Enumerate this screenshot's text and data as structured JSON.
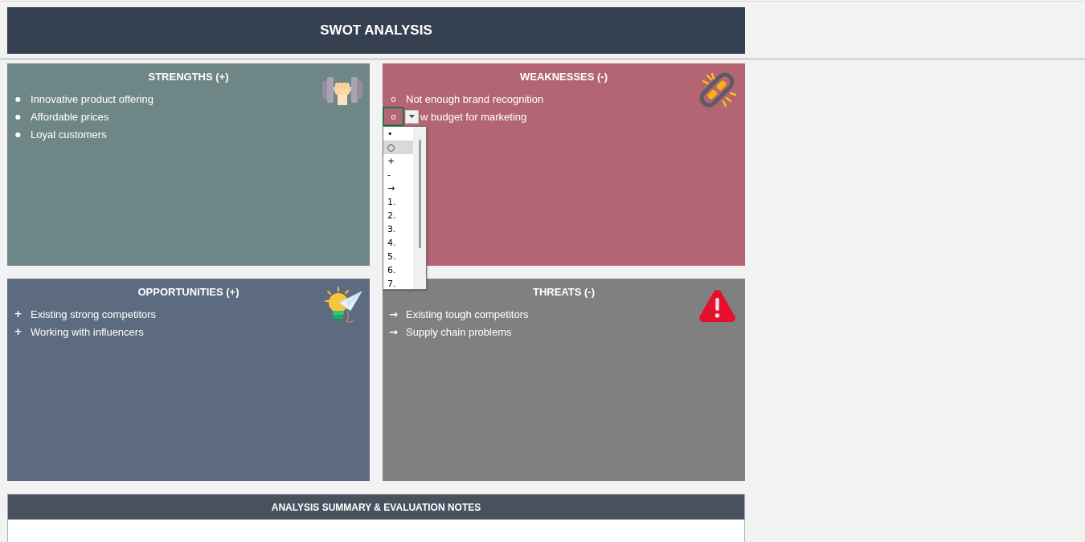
{
  "title": "SWOT ANALYSIS",
  "quadrants": [
    {
      "kind": "strengths",
      "title": "STRENGTHS (+)",
      "color": "#6e8786",
      "items": [
        {
          "marker": "●",
          "text": "Innovative product offering",
          "selected": false
        },
        {
          "marker": "●",
          "text": "Affordable prices",
          "selected": false
        },
        {
          "marker": "●",
          "text": "Loyal customers",
          "selected": false
        }
      ]
    },
    {
      "kind": "weaknesses",
      "title": "WEAKNESSES (-)",
      "color": "#b46574",
      "items": [
        {
          "marker": "o",
          "text": "Not enough brand recognition",
          "selected": false
        },
        {
          "marker": "o",
          "text": "w budget for marketing",
          "selected": true
        }
      ]
    },
    {
      "kind": "opportunities",
      "title": "OPPORTUNITIES (+)",
      "color": "#5d6b80",
      "items": [
        {
          "marker": "+",
          "text": "Existing strong competitors",
          "selected": false
        },
        {
          "marker": "+",
          "text": "Working with influencers",
          "selected": false
        }
      ]
    },
    {
      "kind": "threats",
      "title": "THREATS (-)",
      "color": "#808080",
      "items": [
        {
          "marker": "→",
          "text": "Existing tough competitors",
          "selected": false
        },
        {
          "marker": "→",
          "text": "Supply chain problems",
          "selected": false
        }
      ]
    }
  ],
  "dropdown": {
    "open": true,
    "options": [
      {
        "label": "•",
        "selected": false
      },
      {
        "label": "○",
        "selected": true
      },
      {
        "label": "+",
        "selected": false
      },
      {
        "label": "-",
        "selected": false
      },
      {
        "label": "→",
        "selected": false
      },
      {
        "label": "1.",
        "selected": false
      },
      {
        "label": "2.",
        "selected": false
      },
      {
        "label": "3.",
        "selected": false
      },
      {
        "label": "4.",
        "selected": false
      },
      {
        "label": "5.",
        "selected": false
      },
      {
        "label": "6.",
        "selected": false
      },
      {
        "label": "7.",
        "selected": false
      }
    ]
  },
  "summary": {
    "title": "ANALYSIS SUMMARY & EVALUATION NOTES"
  }
}
